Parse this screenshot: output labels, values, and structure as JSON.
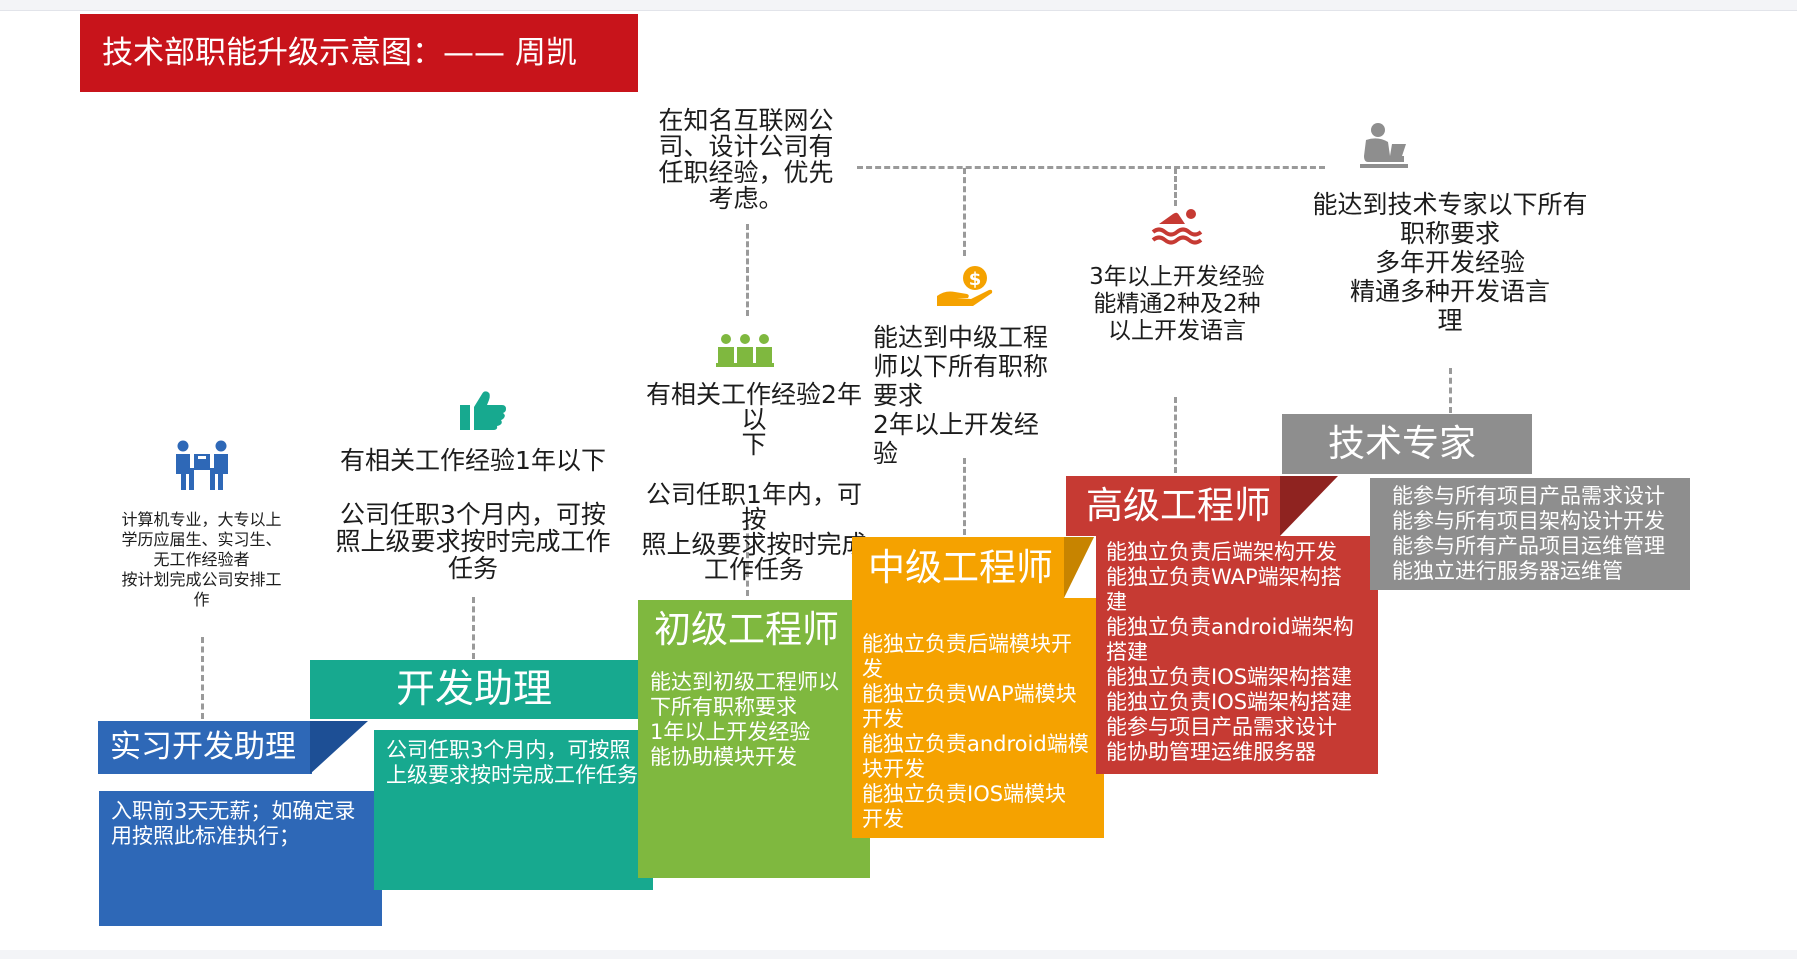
{
  "title": "技术部职能升级示意图：—— 周凯",
  "colors": {
    "title_bg": "#c8141b",
    "intern": "#2e68b7",
    "assistant": "#17a98f",
    "junior": "#7fb83f",
    "middle": "#f5a200",
    "senior": "#c63a33",
    "expert": "#8e8e8e"
  },
  "levels": [
    {
      "name": "实习开发助理",
      "icon": "people-carry-box-icon",
      "requirements": "计算机专业，大专以上\n学历应届生、实习生、\n无工作经验者\n按计划完成公司安排工\n作",
      "duties": "入职前3天无薪；如确定录\n用按照此标准执行；"
    },
    {
      "name": "开发助理",
      "icon": "thumbs-up-icon",
      "requirements": "有相关工作经验1年以下\n\n公司任职3个月内，可按\n照上级要求按时完成工作\n任务",
      "duties": "公司任职3个月内，可按照\n上级要求按时完成工作任务"
    },
    {
      "name": "初级工程师",
      "icon": "team-group-icon",
      "requirements": "有相关工作经验2年以\n下\n\n公司任职1年内，可按\n照上级要求按时完成\n工作任务",
      "duties": "能达到初级工程师以\n下所有职称要求\n1年以上开发经验\n能协助模块开发"
    },
    {
      "name": "中级工程师",
      "icon": "hand-dollar-icon",
      "requirements": "能达到中级工程\n师以下所有职称\n要求\n2年以上开发经\n验",
      "duties": "  能独立负责后端模块开\n发\n  能独立负责WAP端模块\n开发\n  能独立负责android端模\n块开发\n  能独立负责IOS端模块\n开发"
    },
    {
      "name": "高级工程师",
      "icon": "swimmer-icon",
      "requirements": "3年以上开发经验\n能精通2种及2种\n以上开发语言",
      "duties": "能独立负责后端架构开发\n  能独立负责WAP端架构搭\n建\n  能独立负责android端架构\n搭建\n  能独立负责IOS端架构搭建\n  能独立负责IOS端架构搭建\n  能参与项目产品需求设计\n  能协助管理运维服务器"
    },
    {
      "name": "技术专家",
      "icon": "person-laptop-icon",
      "requirements": "能达到技术专家以下所有\n职称要求\n多年开发经验\n精通多种开发语言\n理",
      "duties": "能参与所有项目产品需求设计\n能参与所有项目架构设计开发\n能参与所有产品项目运维管理\n  能独立进行服务器运维管"
    }
  ],
  "note": "在知名互联网公\n司、设计公司有\n任职经验，优先\n考虑。"
}
